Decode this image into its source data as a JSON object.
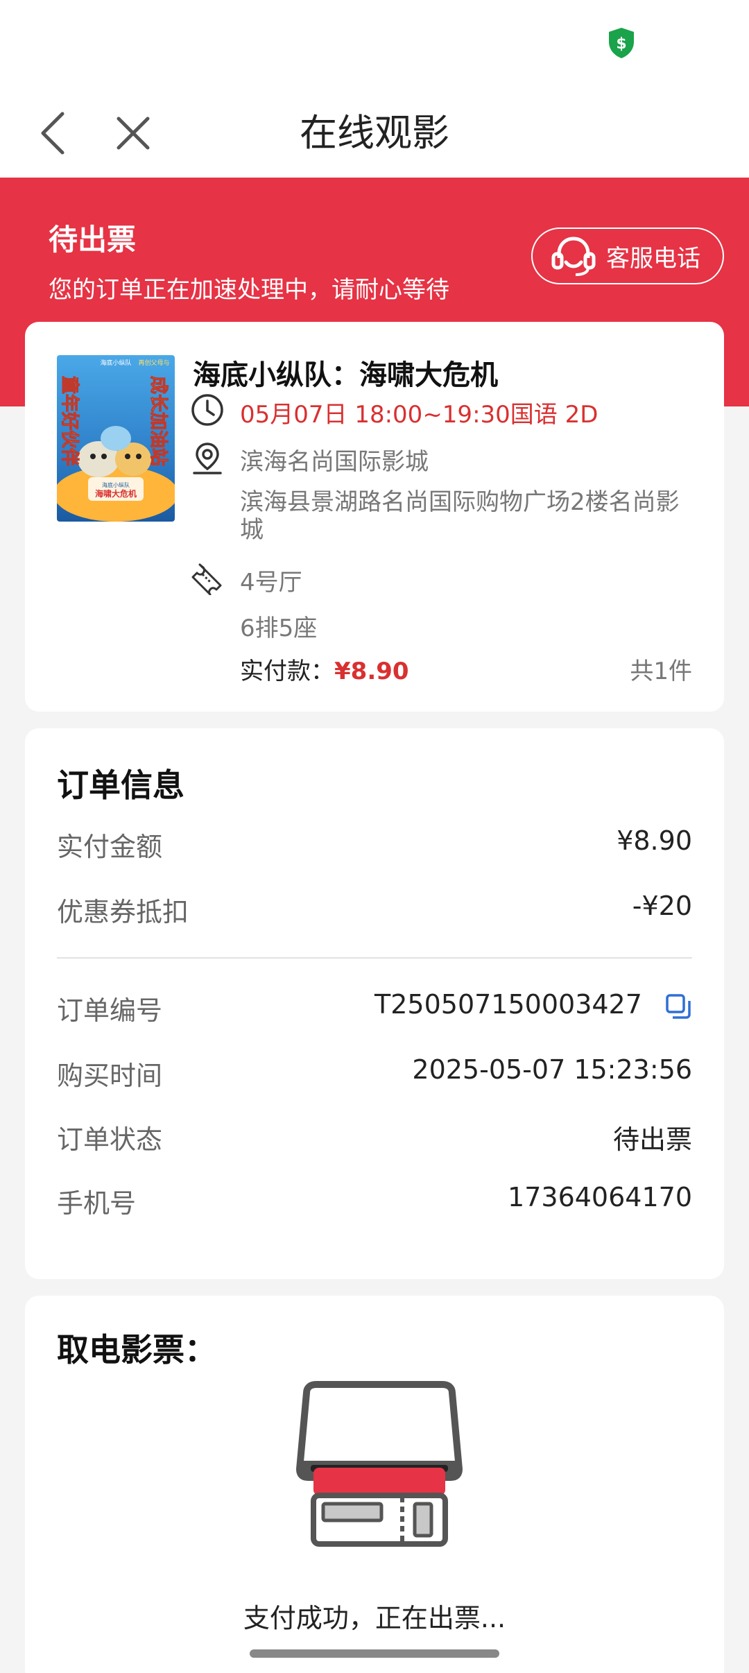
{
  "header": {
    "title": "在线观影"
  },
  "banner": {
    "status": "待出票",
    "message": "您的订单正在加速处理中，请耐心等待",
    "service_button": "客服电话"
  },
  "movie": {
    "poster_texts": [
      "海底小纵队",
      "再创父母与",
      "成长加油站",
      "童年好伙伴",
      "海底小纵队",
      "海啸大危机"
    ],
    "title": "海底小纵队：海啸大危机",
    "showtime": "05月07日 18:00~19:30国语 2D",
    "cinema": "滨海名尚国际影城",
    "address": "滨海县景湖路名尚国际购物广场2楼名尚影城",
    "hall": "4号厅",
    "seat": "6排5座",
    "paid_label": "实付款：",
    "paid_amount": "¥8.90",
    "count": "共1件"
  },
  "order": {
    "title": "订单信息",
    "paid_label": "实付金额",
    "paid_value": "¥8.90",
    "coupon_label": "优惠券抵扣",
    "coupon_value": "-¥20",
    "number_label": "订单编号",
    "number_value": "T250507150003427",
    "time_label": "购买时间",
    "time_value": "2025-05-07 15:23:56",
    "status_label": "订单状态",
    "status_value": "待出票",
    "phone_label": "手机号",
    "phone_value": "17364064170"
  },
  "ticket": {
    "title": "取电影票：",
    "status": "支付成功，正在出票..."
  },
  "colors": {
    "brand_red": "#e63345",
    "price_red": "#d93030",
    "shield_green": "#1aa34a",
    "copy_blue": "#2f6fd6"
  },
  "icons": [
    "shield-dollar-icon",
    "back-arrow-icon",
    "close-icon",
    "headset-icon",
    "clock-icon",
    "location-pin-icon",
    "ticket-icon",
    "copy-icon",
    "ticket-printer-icon"
  ]
}
